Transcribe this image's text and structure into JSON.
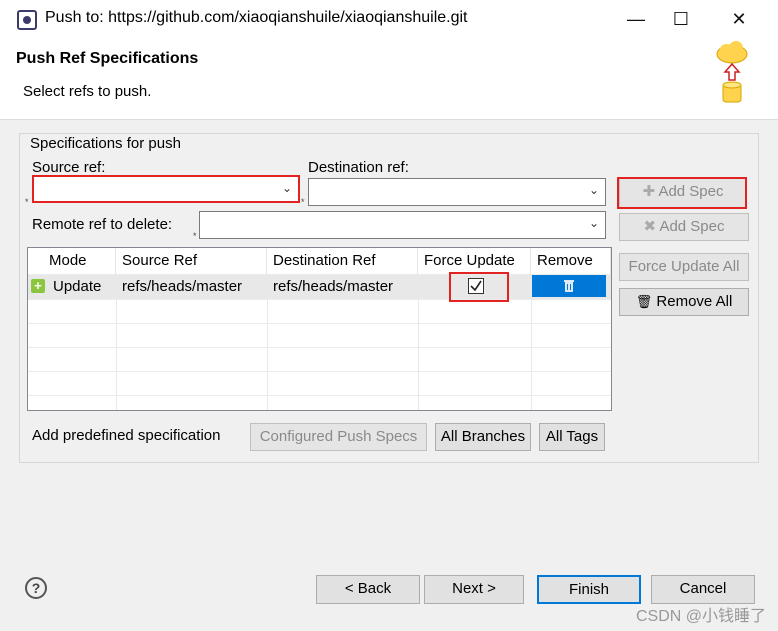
{
  "window": {
    "title": "Push to: https://github.com/xiaoqianshuile/xiaoqianshuile.git"
  },
  "header": {
    "title": "Push Ref Specifications",
    "subtitle": "Select refs to push."
  },
  "group": {
    "label": "Specifications for push"
  },
  "fields": {
    "source_ref_label": "Source ref:",
    "source_ref_value": "",
    "destination_ref_label": "Destination ref:",
    "destination_ref_value": "",
    "remote_delete_label": "Remote ref to delete:",
    "remote_delete_value": ""
  },
  "side_buttons": {
    "add_spec_1": "Add Spec",
    "add_spec_2": "Add Spec",
    "force_update_all": "Force Update All",
    "remove_all": "Remove All"
  },
  "table": {
    "columns": [
      "Mode",
      "Source Ref",
      "Destination Ref",
      "Force Update",
      "Remove"
    ],
    "rows": [
      {
        "mode": "Update",
        "source": "refs/heads/master",
        "destination": "refs/heads/master",
        "force_update": true
      }
    ]
  },
  "predefined": {
    "label": "Add predefined specification",
    "configured": "Configured Push Specs",
    "all_branches": "All Branches",
    "all_tags": "All Tags"
  },
  "footer": {
    "back": "< Back",
    "next": "Next >",
    "finish": "Finish",
    "cancel": "Cancel"
  },
  "watermark": "CSDN @小钱睡了"
}
